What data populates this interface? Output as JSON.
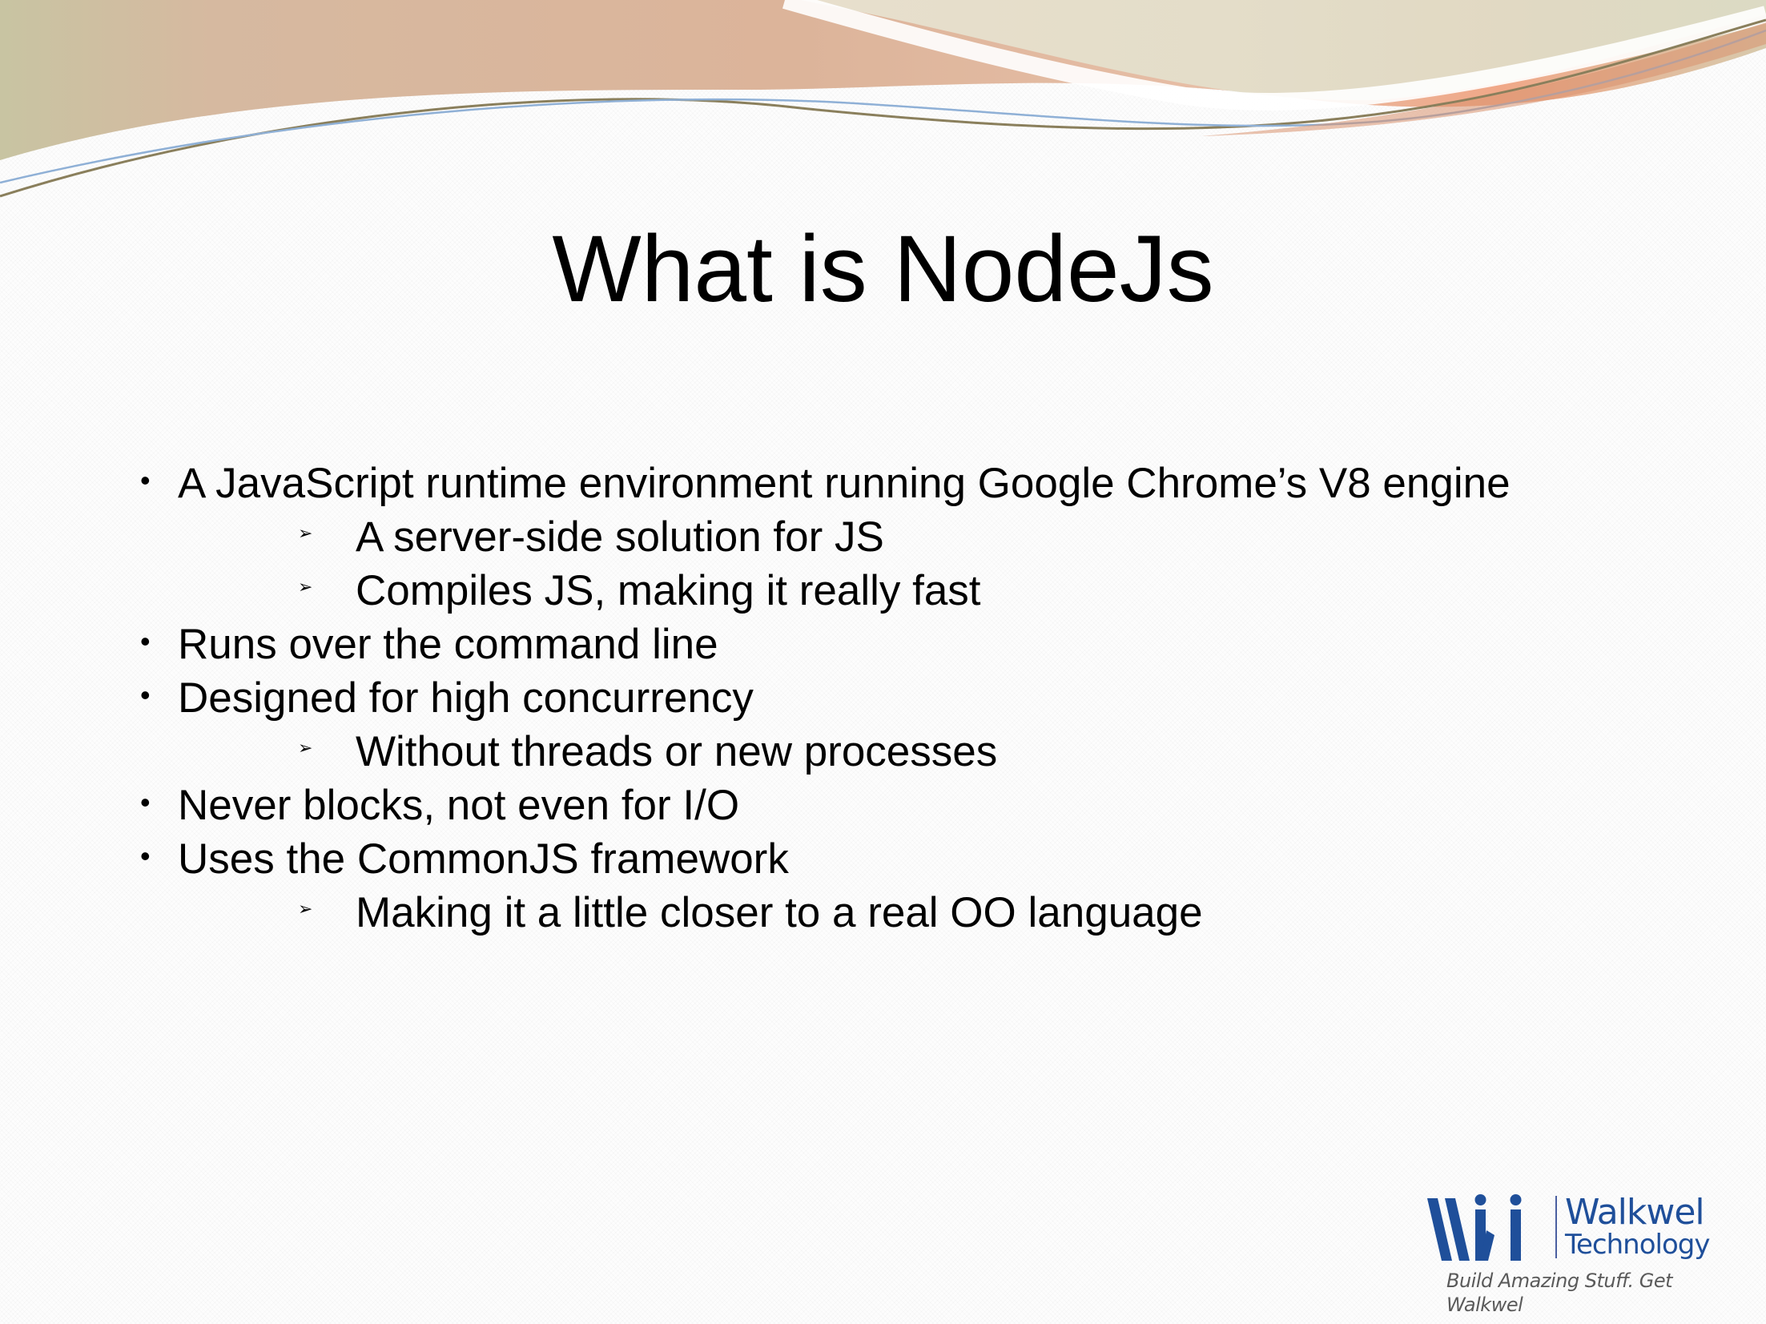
{
  "slide": {
    "title": "What is NodeJs",
    "bullets": [
      {
        "level": 1,
        "marker": "•",
        "text": "A JavaScript runtime environment running Google Chrome’s V8 engine"
      },
      {
        "level": 2,
        "marker": "➢",
        "text": "A server-side solution for JS"
      },
      {
        "level": 2,
        "marker": "➢",
        "text": "Compiles JS, making it really fast"
      },
      {
        "level": 1,
        "marker": "•",
        "text": "Runs over the command line"
      },
      {
        "level": 1,
        "marker": "•",
        "text": "Designed for high concurrency"
      },
      {
        "level": 2,
        "marker": "➢",
        "text": "Without threads or new processes"
      },
      {
        "level": 1,
        "marker": "•",
        "text": "Never blocks, not even for I/O"
      },
      {
        "level": 1,
        "marker": "•",
        "text": "Uses the CommonJS framework"
      },
      {
        "level": 2,
        "marker": "➢",
        "text": "Making it a little closer to a real OO language"
      }
    ]
  },
  "logo": {
    "name": "Walkwel",
    "subname": "Technology",
    "tagline": "Build Amazing Stuff. Get Walkwel",
    "icon": "walkwel-logo-mark"
  },
  "colors": {
    "title": "#000000",
    "text": "#000000",
    "logo_blue": "#1f4f9a",
    "swoosh_tan": "#d9b59b",
    "swoosh_peach": "#eea98a",
    "swoosh_sage": "#c9c6a8"
  }
}
